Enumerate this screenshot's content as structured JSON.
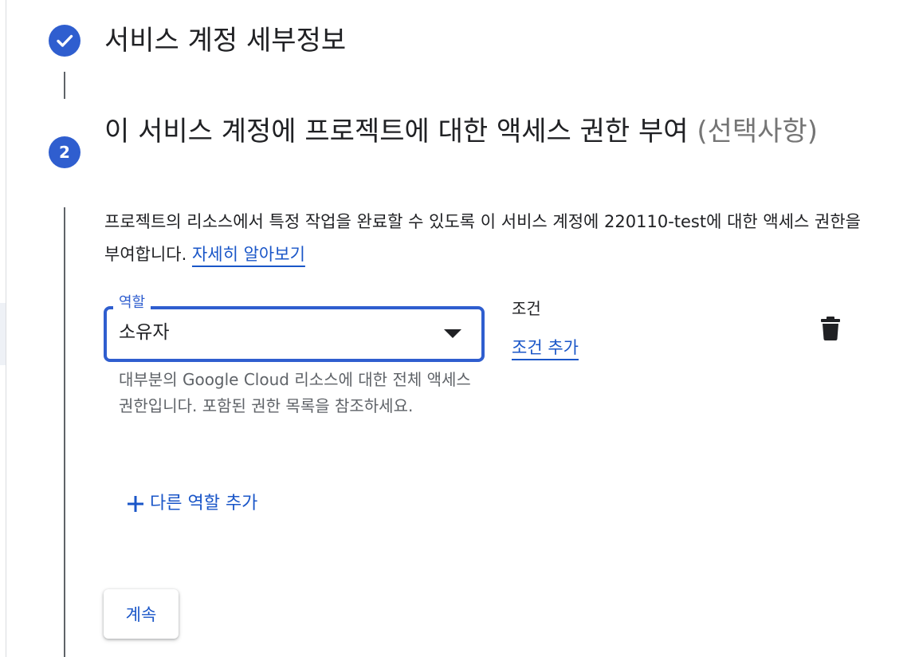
{
  "step1": {
    "title": "서비스 계정 세부정보",
    "status_icon": "check-icon"
  },
  "step2": {
    "number": "2",
    "title_main": "이 서비스 계정에 프로젝트에 대한 액세스 권한 부여",
    "title_optional": "(선택사항)",
    "description": "프로젝트의 리소스에서 특정 작업을 완료할 수 있도록 이 서비스 계정에 220110-test에 대한 액세스 권한을 부여합니다.",
    "learn_more": "자세히 알아보기"
  },
  "role": {
    "label": "역할",
    "value": "소유자",
    "help": "대부분의 Google Cloud 리소스에 대한 전체 액세스 권한입니다. 포함된 권한 목록을 참조하세요."
  },
  "condition": {
    "label": "조건",
    "add_label": "조건 추가"
  },
  "add_role_label": "다른 역할 추가",
  "continue_label": "계속",
  "colors": {
    "accent": "#2f5ecf",
    "link": "#1a56c8",
    "text": "#202124",
    "secondary_text": "#5f6368"
  }
}
